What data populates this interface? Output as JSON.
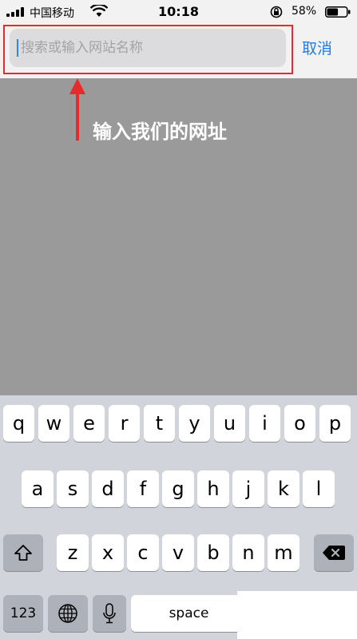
{
  "status_bar": {
    "carrier": "中国移动",
    "time": "10:18",
    "battery_percent": "58%",
    "battery_level": 0.58
  },
  "search": {
    "placeholder": "搜索或输入网站名称",
    "value": "",
    "cancel_label": "取消"
  },
  "annotation": {
    "text": "输入我们的网址",
    "color": "#e52b2b"
  },
  "keyboard": {
    "row1": [
      "q",
      "w",
      "e",
      "r",
      "t",
      "y",
      "u",
      "i",
      "o",
      "p"
    ],
    "row2": [
      "a",
      "s",
      "d",
      "f",
      "g",
      "h",
      "j",
      "k",
      "l"
    ],
    "row3": [
      "z",
      "x",
      "c",
      "v",
      "b",
      "n",
      "m"
    ],
    "numbers_label": "123",
    "space_label": "space",
    "icons": [
      "shift-icon",
      "backspace-icon",
      "globe-icon",
      "microphone-icon"
    ]
  },
  "colors": {
    "accent": "#1a7cf5",
    "highlight": "#e52b2b",
    "overlay": "#9a9a9a"
  }
}
